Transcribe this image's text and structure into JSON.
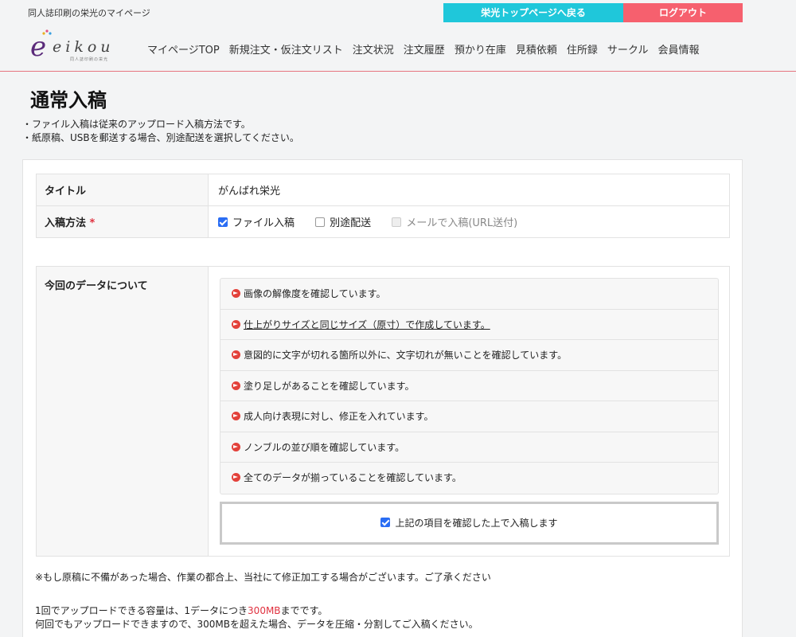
{
  "topbar": {
    "site_name": "同人誌印刷の栄光のマイページ",
    "top_link": "栄光トップページへ戻る",
    "logout": "ログアウト",
    "top_color": "#1fc7da",
    "logout_color": "#f6606e"
  },
  "logo": {
    "word": "eikou",
    "tagline": "同人誌印刷の栄光"
  },
  "nav": [
    "マイページTOP",
    "新規注文・仮注文リスト",
    "注文状況",
    "注文履歴",
    "預かり在庫",
    "見積依頼",
    "住所録",
    "サークル",
    "会員情報"
  ],
  "page": {
    "title": "通常入稿",
    "intro": [
      "・ファイル入稿は従来のアップロード入稿方法です。",
      "・紙原稿、USBを郵送する場合、別途配送を選択してください。"
    ]
  },
  "form": {
    "title_label": "タイトル",
    "title_value": "がんばれ栄光",
    "method_label": "入稿方法",
    "required_mark": "*",
    "methods": [
      {
        "label": "ファイル入稿",
        "checked": true
      },
      {
        "label": "別途配送",
        "checked": false
      },
      {
        "label": "メールで入稿(URL送付)",
        "checked": false,
        "disabled": true
      }
    ]
  },
  "data_check": {
    "label": "今回のデータについて",
    "items": [
      "画像の解像度を確認しています。",
      "仕上がりサイズと同じサイズ（原寸）で作成しています。",
      "意図的に文字が切れる箇所以外に、文字切れが無いことを確認しています。",
      "塗り足しがあることを確認しています。",
      "成人向け表現に対し、修正を入れています。",
      "ノンブルの並び順を確認しています。",
      "全てのデータが揃っていることを確認しています。"
    ],
    "confirm_label": "上記の項目を確認した上で入稿します",
    "confirm_checked": true
  },
  "note": "※もし原稿に不備があった場合、作業の都合上、当社にて修正加工する場合がございます。ご了承ください",
  "upload": {
    "line1_pre": "1回でアップロードできる容量は、1データにつき",
    "line1_limit": "300MB",
    "line1_post": "までです。",
    "line2": "何回でもアップロードできますので、300MBを超えた場合、データを圧縮・分割してご入稿ください。"
  }
}
